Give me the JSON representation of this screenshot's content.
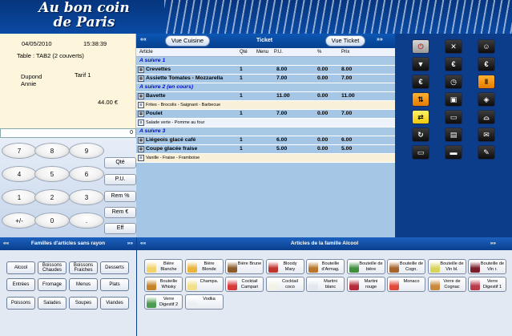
{
  "header": {
    "logo_line1": "Au bon coin",
    "logo_line2": "de Paris"
  },
  "order": {
    "date": "04/05/2010",
    "time": "15:38:39",
    "table": "Table : TAB2 (2 couverts)",
    "waiter_first": "Dupond",
    "waiter_last": "Annie",
    "tariff": "Tarif 1",
    "total": "44.00 €",
    "input_value": "0"
  },
  "keypad": {
    "keys": [
      "7",
      "8",
      "9",
      "4",
      "5",
      "6",
      "1",
      "2",
      "3",
      "+/-",
      "0",
      "."
    ],
    "functions": [
      "Qté",
      "P.U.",
      "Rem %",
      "Rem €",
      "Eff"
    ]
  },
  "ticket": {
    "btn_cuisine": "Vue Cuisine",
    "label": "Ticket",
    "btn_ticket": "Vue Ticket",
    "chev_left": "««",
    "chev_right": "»»",
    "columns": {
      "article": "Article",
      "qty": "Qté",
      "menu": "Menu",
      "pu": "P.U.",
      "pct": "%",
      "price": "Prix"
    },
    "lines": [
      {
        "kind": "group",
        "name": "A suivre 1"
      },
      {
        "kind": "item",
        "name": "Crevettes",
        "qty": "1",
        "pu": "8.00",
        "pct": "0.00",
        "price": "8.00"
      },
      {
        "kind": "item",
        "name": "Assiette Tomates - Mozzarella",
        "qty": "1",
        "pu": "7.00",
        "pct": "0.00",
        "price": "7.00"
      },
      {
        "kind": "group",
        "name": "A suivre 2 (en cours)"
      },
      {
        "kind": "item",
        "name": "Bavette",
        "qty": "1",
        "pu": "11.00",
        "pct": "0.00",
        "price": "11.00"
      },
      {
        "kind": "note",
        "name": "Frites - Brocolis - Saignant - Barbecue"
      },
      {
        "kind": "item",
        "name": "Poulet",
        "qty": "1",
        "pu": "7.00",
        "pct": "0.00",
        "price": "7.00"
      },
      {
        "kind": "notewhite",
        "name": "Salade verte - Pomme au four"
      },
      {
        "kind": "group",
        "name": "A suivre 3"
      },
      {
        "kind": "item",
        "name": "Liégeois glacé café",
        "qty": "1",
        "pu": "6.00",
        "pct": "0.00",
        "price": "6.00"
      },
      {
        "kind": "item",
        "name": "Coupe glacée fraise",
        "qty": "1",
        "pu": "5.00",
        "pct": "0.00",
        "price": "5.00"
      },
      {
        "kind": "note",
        "name": "Vanille - Fraise - Framboise"
      }
    ]
  },
  "functions": [
    {
      "icon": "power-icon",
      "color": "grey",
      "glyph": "⏻"
    },
    {
      "icon": "close-icon",
      "color": "black",
      "glyph": "✕"
    },
    {
      "icon": "waiter-icon",
      "color": "black",
      "glyph": "☺"
    },
    {
      "icon": "bag-icon",
      "color": "black",
      "glyph": "▼"
    },
    {
      "icon": "euro-icon",
      "color": "black",
      "glyph": "€"
    },
    {
      "icon": "euro-split-icon",
      "color": "black",
      "glyph": "€"
    },
    {
      "icon": "euro-coins-icon",
      "color": "black",
      "glyph": "€"
    },
    {
      "icon": "clock-icon",
      "color": "black",
      "glyph": "◷"
    },
    {
      "icon": "cutlery-icon",
      "color": "orange",
      "glyph": "‖"
    },
    {
      "icon": "transfer-icon",
      "color": "orange",
      "glyph": "⇅"
    },
    {
      "icon": "table-icon",
      "color": "black",
      "glyph": "▣"
    },
    {
      "icon": "table-group-icon",
      "color": "black",
      "glyph": "◈"
    },
    {
      "icon": "pay-icon",
      "color": "yellow",
      "glyph": "⇄"
    },
    {
      "icon": "wallet-icon",
      "color": "black",
      "glyph": "▭"
    },
    {
      "icon": "dish-icon",
      "color": "black",
      "glyph": "⌓"
    },
    {
      "icon": "rotate-icon",
      "color": "black",
      "glyph": "↻"
    },
    {
      "icon": "ticket-print-icon",
      "color": "black",
      "glyph": "▤"
    },
    {
      "icon": "gift-icon",
      "color": "black",
      "glyph": "✉"
    },
    {
      "icon": "card-icon",
      "color": "black",
      "glyph": "▭"
    },
    {
      "icon": "credit-card-icon",
      "color": "black",
      "glyph": "▬"
    },
    {
      "icon": "note-icon",
      "color": "black",
      "glyph": "✎"
    }
  ],
  "families": {
    "header": "Familles d'articles sans rayon",
    "chev_left": "««",
    "chev_right": "»»",
    "items": [
      "Alcool",
      "Boissons Chaudes",
      "Boissons Fraiches",
      "Desserts",
      "Entrées",
      "Fromage",
      "Menus",
      "Plats",
      "Poissons",
      "Salades",
      "Soupes",
      "Viandes"
    ]
  },
  "articles": {
    "header": "Articles de la famille Alcool",
    "chev_left": "««",
    "chev_right": "»»",
    "items": [
      {
        "label": "Bière Blanche",
        "color": "#f1d36b"
      },
      {
        "label": "Bière Blonde",
        "color": "#e9b53a"
      },
      {
        "label": "Bière Brune",
        "color": "#8b5a2b"
      },
      {
        "label": "Bloody Mary",
        "color": "#c0332e"
      },
      {
        "label": "Bouteille d'Armag.",
        "color": "#b9762a"
      },
      {
        "label": "Bouteille de bière",
        "color": "#3f8f3f"
      },
      {
        "label": "Bouteille de Cogn.",
        "color": "#a5622a"
      },
      {
        "label": "Bouteille de Vin bl.",
        "color": "#d8d35a"
      },
      {
        "label": "Bouteille de Vin r.",
        "color": "#7a1d2a"
      },
      {
        "label": "Bouteille Whisky",
        "color": "#c3842c"
      },
      {
        "label": "Champa.",
        "color": "#f0e08a"
      },
      {
        "label": "Cocktail Campari",
        "color": "#d83a3a"
      },
      {
        "label": "Cocktail coco",
        "color": "#f2f2e6"
      },
      {
        "label": "Martini blanc",
        "color": "#e3e8ee"
      },
      {
        "label": "Martini rouge",
        "color": "#b52b3b"
      },
      {
        "label": "Monaco",
        "color": "#e1493a"
      },
      {
        "label": "Verre de Cognac",
        "color": "#c98a3d"
      },
      {
        "label": "Verre Digestif 1",
        "color": "#b93a4a"
      },
      {
        "label": "Verre Digestif 2",
        "color": "#4d9a52"
      },
      {
        "label": "Vodka",
        "color": "#e9eef2"
      }
    ]
  }
}
